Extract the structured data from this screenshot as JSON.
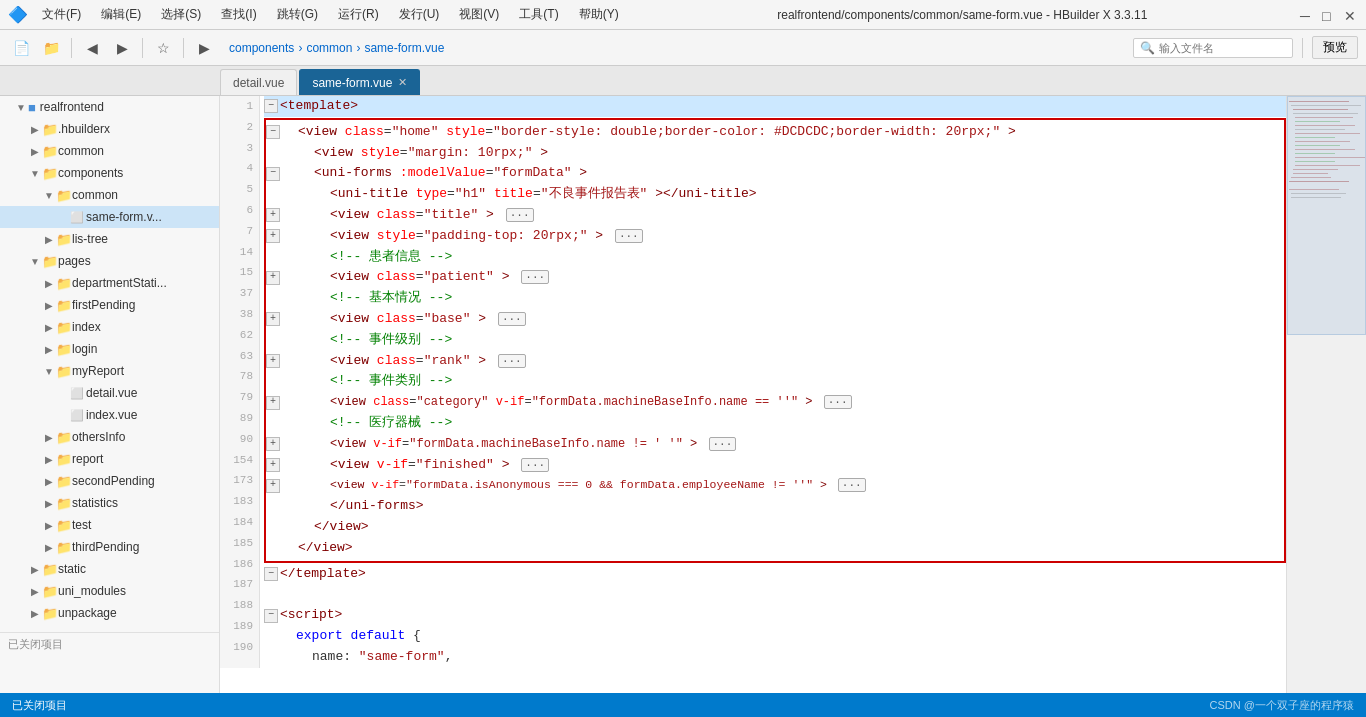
{
  "titlebar": {
    "title": "realfrontend/components/common/same-form.vue - HBuilder X 3.3.11",
    "window_controls": [
      "minimize",
      "maximize",
      "close"
    ]
  },
  "menubar": {
    "items": [
      "文件(F)",
      "编辑(E)",
      "选择(S)",
      "查找(I)",
      "跳转(G)",
      "运行(R)",
      "发行(U)",
      "视图(V)",
      "工具(T)",
      "帮助(Y)"
    ]
  },
  "addressbar": {
    "breadcrumbs": [
      "components",
      "common",
      "same-form.vue"
    ],
    "search_placeholder": "输入文件名",
    "preview_label": "预览"
  },
  "tabs": [
    {
      "label": "detail.vue",
      "active": false
    },
    {
      "label": "same-form.vue",
      "active": true,
      "closable": true
    }
  ],
  "sidebar": {
    "title": "realfrontend",
    "items": [
      {
        "id": "hbuilderx",
        "label": ".hbuilderx",
        "type": "folder",
        "level": 1,
        "expanded": false
      },
      {
        "id": "common",
        "label": "common",
        "type": "folder",
        "level": 1,
        "expanded": false
      },
      {
        "id": "components",
        "label": "components",
        "type": "folder",
        "level": 1,
        "expanded": true
      },
      {
        "id": "components-common",
        "label": "common",
        "type": "folder",
        "level": 2,
        "expanded": true
      },
      {
        "id": "same-form",
        "label": "same-form.v...",
        "type": "file",
        "level": 3,
        "active": true
      },
      {
        "id": "lis-tree",
        "label": "lis-tree",
        "type": "folder",
        "level": 2,
        "expanded": false
      },
      {
        "id": "pages",
        "label": "pages",
        "type": "folder",
        "level": 1,
        "expanded": true
      },
      {
        "id": "departmentStati",
        "label": "departmentStati...",
        "type": "folder",
        "level": 2,
        "expanded": false
      },
      {
        "id": "firstPending",
        "label": "firstPending",
        "type": "folder",
        "level": 2,
        "expanded": false
      },
      {
        "id": "index",
        "label": "index",
        "type": "folder",
        "level": 2,
        "expanded": false
      },
      {
        "id": "login",
        "label": "login",
        "type": "folder",
        "level": 2,
        "expanded": false
      },
      {
        "id": "myReport",
        "label": "myReport",
        "type": "folder",
        "level": 2,
        "expanded": true
      },
      {
        "id": "detail-vue",
        "label": "detail.vue",
        "type": "file",
        "level": 3
      },
      {
        "id": "index-vue",
        "label": "index.vue",
        "type": "file",
        "level": 3
      },
      {
        "id": "othersInfo",
        "label": "othersInfo",
        "type": "folder",
        "level": 2,
        "expanded": false
      },
      {
        "id": "report",
        "label": "report",
        "type": "folder",
        "level": 2,
        "expanded": false
      },
      {
        "id": "secondPending",
        "label": "secondPending",
        "type": "folder",
        "level": 2,
        "expanded": false
      },
      {
        "id": "statistics",
        "label": "statistics",
        "type": "folder",
        "level": 2,
        "expanded": false
      },
      {
        "id": "test",
        "label": "test",
        "type": "folder",
        "level": 2,
        "expanded": false
      },
      {
        "id": "thirdPending",
        "label": "thirdPending",
        "type": "folder",
        "level": 2,
        "expanded": false
      },
      {
        "id": "static",
        "label": "static",
        "type": "folder",
        "level": 1,
        "expanded": false
      },
      {
        "id": "uni_modules",
        "label": "uni_modules",
        "type": "folder",
        "level": 1,
        "expanded": false
      },
      {
        "id": "unpackage",
        "label": "unpackage",
        "type": "folder",
        "level": 1,
        "expanded": false
      }
    ],
    "footer": "已关闭项目"
  },
  "code_lines": [
    {
      "num": 1,
      "fold": "closed",
      "selected": true,
      "content": "<template>"
    },
    {
      "num": 2,
      "fold": "open",
      "content": "    <view class=\"home\" style=\"border-style: double;border-color: #DCDCDC;border-width: 20rpx;\">"
    },
    {
      "num": 3,
      "content": "        <view style=\"margin: 10rpx;\">"
    },
    {
      "num": 4,
      "fold": "open",
      "content": "        <uni-forms :modelValue=\"formData\">"
    },
    {
      "num": 5,
      "content": "            <uni-title type=\"h1\" title=\"不良事件报告表\"></uni-title>"
    },
    {
      "num": 6,
      "fold": "open",
      "content": "            <view class=\"title\"> [···]"
    },
    {
      "num": 7,
      "fold": "open",
      "content": "            <view style=\"padding-top: 20rpx;\"> [···]"
    },
    {
      "num": 14,
      "content": "            <!-- 患者信息 -->"
    },
    {
      "num": 15,
      "fold": "open",
      "content": "            <view class=\"patient\"> [···]"
    },
    {
      "num": 37,
      "content": "            <!-- 基本情况 -->"
    },
    {
      "num": 38,
      "fold": "open",
      "content": "            <view class=\"base\"> [···]"
    },
    {
      "num": 62,
      "content": "            <!-- 事件级别 -->"
    },
    {
      "num": 63,
      "fold": "open",
      "content": "            <view class=\"rank\"> [···]"
    },
    {
      "num": 78,
      "content": "            <!-- 事件类别 -->"
    },
    {
      "num": 79,
      "fold": "open",
      "content": "            <view class=\"category\" v-if=\"formData.machineBaseInfo.name == ''\"> [···]"
    },
    {
      "num": 89,
      "content": "            <!-- 医疗器械 -->"
    },
    {
      "num": 90,
      "fold": "open",
      "content": "            <view v-if=\"formData.machineBaseInfo.name != ' '\"> [···]"
    },
    {
      "num": 154,
      "fold": "open",
      "content": "            <view v-if=\"finished\"> [···]"
    },
    {
      "num": 173,
      "fold": "open",
      "content": "            <view  v-if=\"formData.isAnonymous === 0 && formData.employeeName != ''\"> [···]"
    },
    {
      "num": 183,
      "content": "        </uni-forms>"
    },
    {
      "num": 184,
      "content": "        </view>"
    },
    {
      "num": 185,
      "content": "    </view>"
    },
    {
      "num": 186,
      "fold": "closed",
      "content": "</template>"
    },
    {
      "num": 187,
      "content": ""
    },
    {
      "num": 188,
      "fold": "open",
      "content": "<script>"
    },
    {
      "num": 189,
      "content": "    export default {"
    },
    {
      "num": 190,
      "content": "        name: \"same-form\","
    }
  ],
  "statusbar": {
    "left_items": [
      "已关闭项目"
    ],
    "watermark": "CSDN @一个双子座的程序猿",
    "right_items": []
  }
}
